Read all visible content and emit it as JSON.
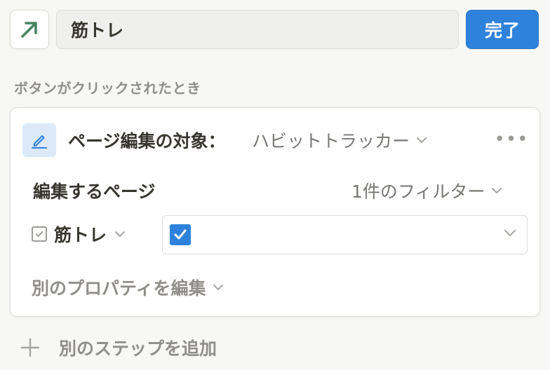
{
  "header": {
    "icon": "arrow-up-right-icon",
    "icon_color": "#448361",
    "button_name": "筋トレ",
    "done_label": "完了",
    "done_color": "#2e82db"
  },
  "section_label": "ボタンがクリックされたとき",
  "action": {
    "icon": "edit-pencil-icon",
    "title": "ページ編集の対象：",
    "target_database": "ハビットトラッカー",
    "more_label": "•••",
    "pages_label": "編集するページ",
    "filter_label": "1件のフィルター",
    "property": {
      "icon": "checkbox-property-icon",
      "name": "筋トレ",
      "value_checked": true
    },
    "edit_other_label": "別のプロパティを編集"
  },
  "add_step": {
    "icon": "plus-icon",
    "label": "別のステップを追加"
  }
}
